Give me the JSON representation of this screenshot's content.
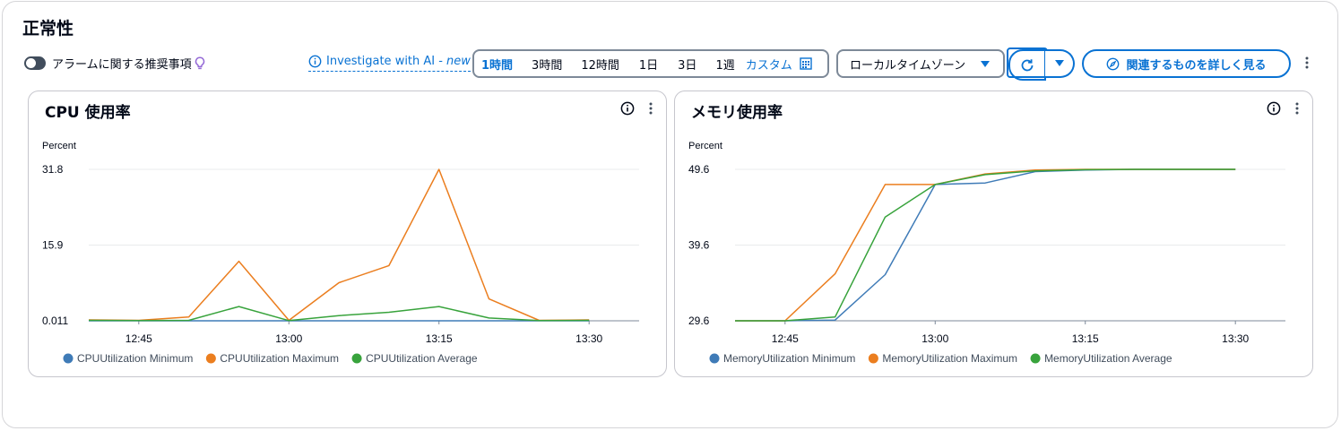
{
  "page": {
    "title": "正常性"
  },
  "alarm_toggle": {
    "label": "アラームに関する推奨事項",
    "on": false
  },
  "ai_link": {
    "label": "Investigate with AI - ",
    "badge": "new"
  },
  "time_range": {
    "options": [
      "1時間",
      "3時間",
      "12時間",
      "1日",
      "3日",
      "1週"
    ],
    "selected": "1時間",
    "custom_label": "カスタム"
  },
  "timezone": {
    "value": "ローカルタイムゾーン"
  },
  "explore_button": {
    "label": "関連するものを詳しく見る"
  },
  "colors": {
    "accent": "#0972d3",
    "series_min": "#3f7bb7",
    "series_max": "#eb7e1f",
    "series_avg": "#38a33c"
  },
  "widgets": [
    {
      "title": "CPU 使用率",
      "unit": "Percent"
    },
    {
      "title": "メモリ使用率",
      "unit": "Percent"
    }
  ],
  "chart_data": [
    {
      "type": "line",
      "title": "CPU 使用率",
      "ylabel": "Percent",
      "ylim": [
        0.011,
        31.8
      ],
      "yticks": [
        {
          "value": 31.8,
          "label": "31.8"
        },
        {
          "value": 15.9,
          "label": "15.9"
        },
        {
          "value": 0.011,
          "label": "0.011"
        }
      ],
      "xlim": [
        "12:40",
        "13:35"
      ],
      "xticks": [
        "12:45",
        "13:00",
        "13:15",
        "13:30"
      ],
      "x": [
        "12:40",
        "12:45",
        "12:50",
        "12:55",
        "13:00",
        "13:05",
        "13:10",
        "13:15",
        "13:20",
        "13:25",
        "13:30"
      ],
      "grid": true,
      "legend": "bottom",
      "series": [
        {
          "name": "CPUUtilization Minimum",
          "color": "#3f7bb7",
          "values": [
            0.011,
            0.011,
            0.011,
            0.011,
            0.011,
            0.011,
            0.011,
            0.011,
            0.011,
            0.011,
            0.011
          ]
        },
        {
          "name": "CPUUtilization Maximum",
          "color": "#eb7e1f",
          "values": [
            0.2,
            0.1,
            0.8,
            12.5,
            0.1,
            8.0,
            11.6,
            31.8,
            4.6,
            0.1,
            0.2
          ]
        },
        {
          "name": "CPUUtilization Average",
          "color": "#38a33c",
          "values": [
            0.1,
            0.05,
            0.1,
            3.0,
            0.05,
            1.1,
            1.8,
            3.0,
            0.6,
            0.05,
            0.1
          ]
        }
      ]
    },
    {
      "type": "line",
      "title": "メモリ使用率",
      "ylabel": "Percent",
      "ylim": [
        29.6,
        49.6
      ],
      "yticks": [
        {
          "value": 49.6,
          "label": "49.6"
        },
        {
          "value": 39.6,
          "label": "39.6"
        },
        {
          "value": 29.6,
          "label": "29.6"
        }
      ],
      "xlim": [
        "12:40",
        "13:35"
      ],
      "xticks": [
        "12:45",
        "13:00",
        "13:15",
        "13:30"
      ],
      "x": [
        "12:40",
        "12:45",
        "12:50",
        "12:55",
        "13:00",
        "13:05",
        "13:10",
        "13:15",
        "13:20",
        "13:25",
        "13:30"
      ],
      "grid": true,
      "legend": "bottom",
      "series": [
        {
          "name": "MemoryUtilization Minimum",
          "color": "#3f7bb7",
          "values": [
            29.6,
            29.6,
            29.7,
            35.7,
            47.6,
            47.8,
            49.3,
            49.5,
            49.6,
            49.6,
            49.6
          ]
        },
        {
          "name": "MemoryUtilization Maximum",
          "color": "#eb7e1f",
          "values": [
            29.6,
            29.6,
            35.8,
            47.6,
            47.6,
            49.0,
            49.5,
            49.6,
            49.6,
            49.6,
            49.6
          ]
        },
        {
          "name": "MemoryUtilization Average",
          "color": "#38a33c",
          "values": [
            29.6,
            29.6,
            30.1,
            43.3,
            47.6,
            48.9,
            49.4,
            49.55,
            49.6,
            49.6,
            49.6
          ]
        }
      ]
    }
  ]
}
